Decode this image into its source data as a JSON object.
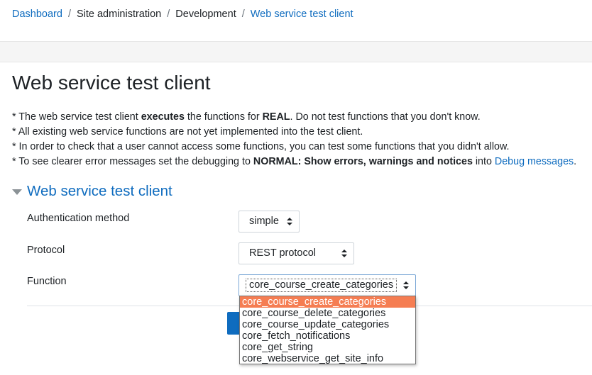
{
  "breadcrumb": {
    "items": [
      "Dashboard",
      "Site administration",
      "Development",
      "Web service test client"
    ],
    "separator": "/"
  },
  "page": {
    "title": "Web service test client"
  },
  "notes": {
    "line1": {
      "a": "* The web service test client ",
      "b": "executes",
      "c": " the functions for ",
      "d": "REAL",
      "e": ". Do not test functions that you don't know."
    },
    "line2": "* All existing web service functions are not yet implemented into the test client.",
    "line3": "* In order to check that a user cannot access some functions, you can test some functions that you didn't allow.",
    "line4": {
      "a": "* To see clearer error messages set the debugging to ",
      "b": "NORMAL: Show errors, warnings and notices",
      "c": " into ",
      "link": "Debug messages",
      "d": "."
    }
  },
  "form": {
    "legend": "Web service test client",
    "auth": {
      "label": "Authentication method",
      "value": "simple"
    },
    "protocol": {
      "label": "Protocol",
      "value": "REST protocol"
    },
    "function": {
      "label": "Function",
      "value": "core_course_create_categories",
      "options": [
        "core_course_create_categories",
        "core_course_delete_categories",
        "core_course_update_categories",
        "core_fetch_notifications",
        "core_get_string",
        "core_webservice_get_site_info"
      ],
      "selected_index": 0
    }
  },
  "icons": {
    "select_arrows": "updown-arrows-icon",
    "collapse": "caret-down-icon"
  },
  "colors": {
    "link": "#0f6cbf",
    "highlight": "#f57d52",
    "primary": "#0f6cbf"
  }
}
